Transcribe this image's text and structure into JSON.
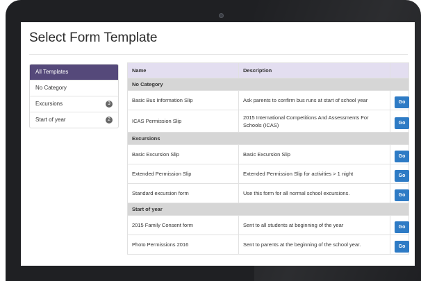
{
  "page_title": "Select Form Template",
  "sidebar": {
    "items": [
      {
        "label": "All Templates",
        "badge": null,
        "active": true
      },
      {
        "label": "No Category",
        "badge": null,
        "active": false
      },
      {
        "label": "Excursions",
        "badge": "3",
        "active": false
      },
      {
        "label": "Start of year",
        "badge": "2",
        "active": false
      }
    ]
  },
  "table": {
    "columns": [
      "Name",
      "Description",
      ""
    ],
    "groups": [
      {
        "title": "No Category",
        "rows": [
          {
            "name": "Basic Bus Information Slip",
            "description": "Ask parents to confirm bus runs at start of school year",
            "action": "Go"
          },
          {
            "name": "ICAS Permission Slip",
            "description": "2015 International Competitions And Assessments For Schools (ICAS)",
            "action": "Go"
          }
        ]
      },
      {
        "title": "Excursions",
        "rows": [
          {
            "name": "Basic Excursion Slip",
            "description": "Basic Excursion Slip",
            "action": "Go"
          },
          {
            "name": "Extended Permission Slip",
            "description": "Extended Permission Slip for activities > 1 night",
            "action": "Go"
          },
          {
            "name": "Standard excursion form",
            "description": "Use this form for all normal school excursions.",
            "action": "Go"
          }
        ]
      },
      {
        "title": "Start of year",
        "rows": [
          {
            "name": "2015 Family Consent form",
            "description": "Sent to all students at beginning of the year",
            "action": "Go"
          },
          {
            "name": "Photo Permissions 2016",
            "description": "Sent to parents at the beginning of the school year.",
            "action": "Go"
          }
        ]
      }
    ]
  },
  "colors": {
    "active_sidebar": "#55497a",
    "header_bg": "#e3def0",
    "group_bg": "#d6d6d6",
    "go_button": "#2e7bc5",
    "badge": "#666666"
  }
}
